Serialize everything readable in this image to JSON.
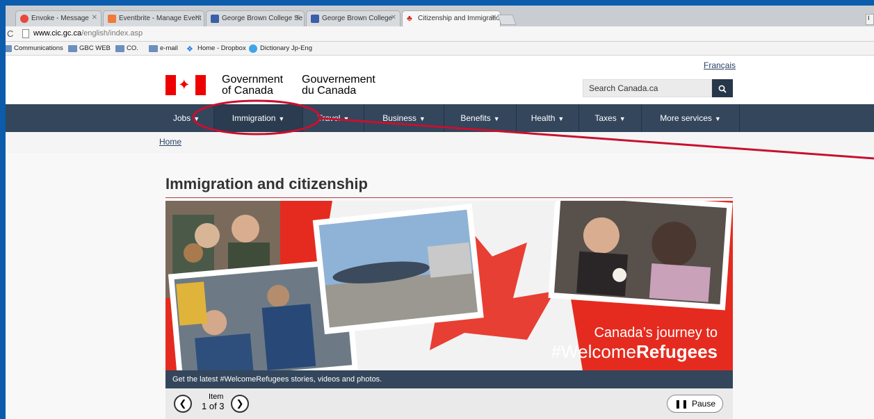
{
  "browser": {
    "tabs": [
      {
        "title": "Envoke - Message",
        "color": "#e8483f"
      },
      {
        "title": "Eventbrite - Manage Event",
        "color": "#ef7a3a"
      },
      {
        "title": "George Brown College Se",
        "color": "#3a5ea8"
      },
      {
        "title": "George Brown College",
        "color": "#3a5ea8"
      },
      {
        "title": "Citizenship and Immigratio",
        "color": "#d52b1e"
      }
    ],
    "url_domain": "www.cic.gc.ca",
    "url_path": "/english/index.asp",
    "bookmarks": [
      "Communications",
      "GBC WEB",
      "CO.",
      "e-mail",
      "Home - Dropbox",
      "Dictionary Jp-Eng"
    ]
  },
  "header": {
    "language_link": "Français",
    "gov_en_line1": "Government",
    "gov_en_line2": "of Canada",
    "gov_fr_line1": "Gouvernement",
    "gov_fr_line2": "du Canada",
    "search_placeholder": "Search Canada.ca"
  },
  "nav": {
    "items": [
      "Jobs",
      "Immigration",
      "Travel",
      "Business",
      "Benefits",
      "Health",
      "Taxes",
      "More services"
    ]
  },
  "breadcrumb": {
    "home": "Home"
  },
  "main": {
    "title": "Immigration and citizenship",
    "banner_line1": "Canada’s journey to",
    "banner_line2_prefix": "#Welcome",
    "banner_line2_bold": "Refugees",
    "caption": "Get the latest #WelcomeRefugees stories, videos and photos.",
    "item_label": "Item",
    "item_count": "1 of 3",
    "pause_label": "Pause"
  },
  "colors": {
    "nav_bg": "#33465c",
    "banner_red": "#e52b1f",
    "annotation_red": "#c8102e",
    "frame_blue": "#0b5cad"
  }
}
